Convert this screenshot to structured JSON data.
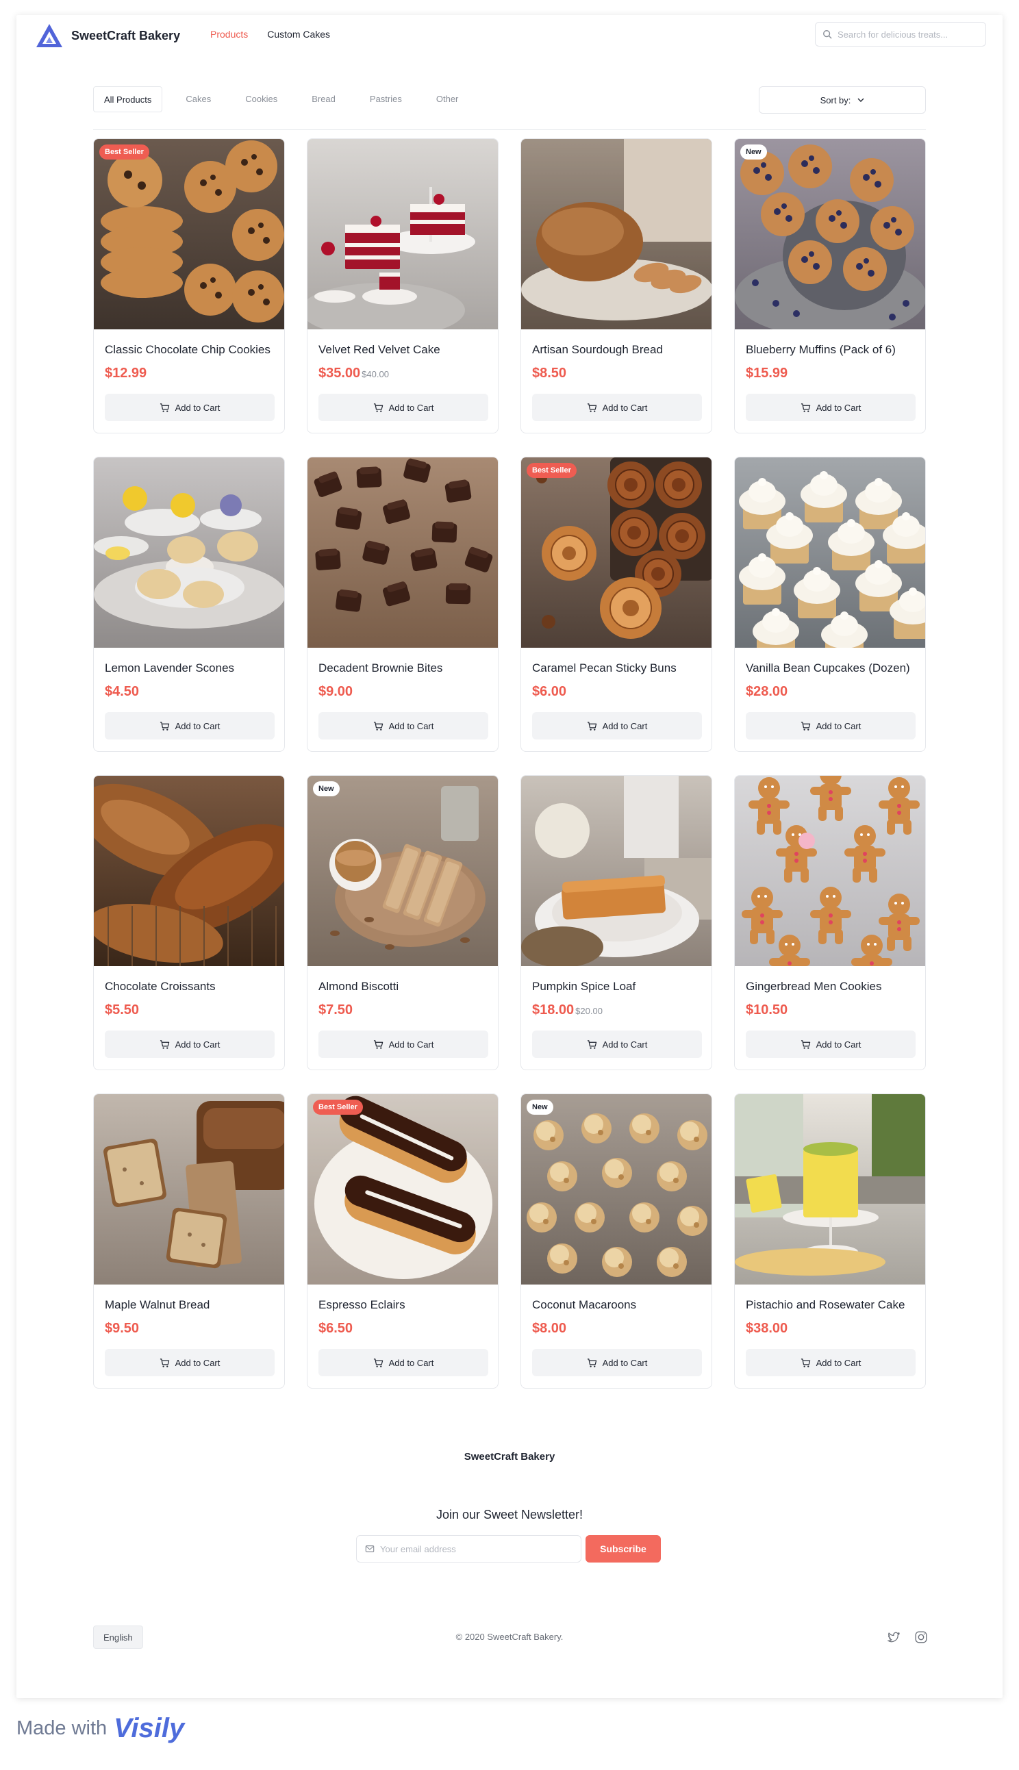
{
  "header": {
    "brand": "SweetCraft Bakery",
    "nav": [
      {
        "label": "Products",
        "active": true
      },
      {
        "label": "Custom Cakes",
        "active": false
      }
    ],
    "search_placeholder": "Search for delicious treats..."
  },
  "filters": {
    "tabs": [
      {
        "label": "All Products",
        "active": true
      },
      {
        "label": "Cakes",
        "active": false
      },
      {
        "label": "Cookies",
        "active": false
      },
      {
        "label": "Bread",
        "active": false
      },
      {
        "label": "Pastries",
        "active": false
      },
      {
        "label": "Other",
        "active": false
      }
    ],
    "sort_label": "Sort by:"
  },
  "products": [
    {
      "name": "Classic Chocolate Chip Cookies",
      "price": "$12.99",
      "old_price": "",
      "badge": "Best Seller",
      "image": "cookies"
    },
    {
      "name": "Velvet Red Velvet Cake",
      "price": "$35.00",
      "old_price": "$40.00",
      "badge": "",
      "image": "red-velvet-cake"
    },
    {
      "name": "Artisan Sourdough Bread",
      "price": "$8.50",
      "old_price": "",
      "badge": "",
      "image": "sourdough"
    },
    {
      "name": "Blueberry Muffins (Pack of 6)",
      "price": "$15.99",
      "old_price": "",
      "badge": "New",
      "image": "muffins"
    },
    {
      "name": "Lemon Lavender Scones",
      "price": "$4.50",
      "old_price": "",
      "badge": "",
      "image": "scones"
    },
    {
      "name": "Decadent Brownie Bites",
      "price": "$9.00",
      "old_price": "",
      "badge": "",
      "image": "brownies"
    },
    {
      "name": "Caramel Pecan Sticky Buns",
      "price": "$6.00",
      "old_price": "",
      "badge": "Best Seller",
      "image": "sticky-buns"
    },
    {
      "name": "Vanilla Bean Cupcakes (Dozen)",
      "price": "$28.00",
      "old_price": "",
      "badge": "",
      "image": "cupcakes"
    },
    {
      "name": "Chocolate Croissants",
      "price": "$5.50",
      "old_price": "",
      "badge": "",
      "image": "croissants"
    },
    {
      "name": "Almond Biscotti",
      "price": "$7.50",
      "old_price": "",
      "badge": "New",
      "image": "biscotti"
    },
    {
      "name": "Pumpkin Spice Loaf",
      "price": "$18.00",
      "old_price": "$20.00",
      "badge": "",
      "image": "pumpkin-loaf"
    },
    {
      "name": "Gingerbread Men Cookies",
      "price": "$10.50",
      "old_price": "",
      "badge": "",
      "image": "gingerbread"
    },
    {
      "name": "Maple Walnut Bread",
      "price": "$9.50",
      "old_price": "",
      "badge": "",
      "image": "walnut-bread"
    },
    {
      "name": "Espresso Eclairs",
      "price": "$6.50",
      "old_price": "",
      "badge": "Best Seller",
      "image": "eclairs"
    },
    {
      "name": "Coconut Macaroons",
      "price": "$8.00",
      "old_price": "",
      "badge": "New",
      "image": "macaroons"
    },
    {
      "name": "Pistachio and Rosewater Cake",
      "price": "$38.00",
      "old_price": "",
      "badge": "",
      "image": "pistachio-cake"
    }
  ],
  "cart_label": "Add to Cart",
  "footer": {
    "brand": "SweetCraft Bakery",
    "newsletter_title": "Join our Sweet Newsletter!",
    "email_placeholder": "Your email address",
    "subscribe_label": "Subscribe",
    "language": "English",
    "copyright": "© 2020 SweetCraft Bakery.",
    "socials": [
      "twitter-icon",
      "instagram-icon"
    ]
  },
  "watermark": {
    "text": "Made with",
    "logo": "Visily"
  },
  "colors": {
    "accent": "#ee5b4f",
    "badge_best": "#ef5d52",
    "subscribe": "#f36a5e",
    "brand_logo": "#4e6cdb"
  }
}
